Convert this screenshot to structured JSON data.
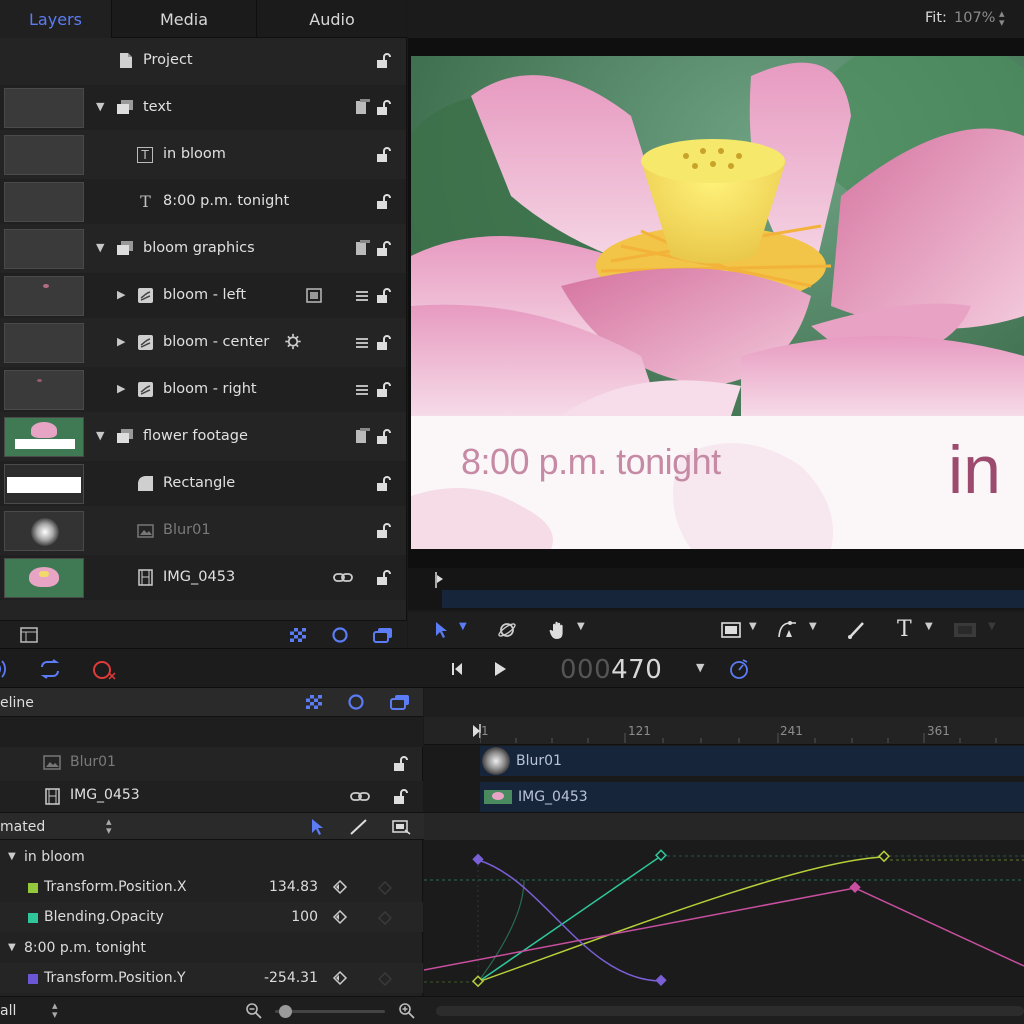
{
  "tabs": [
    {
      "label": "Layers",
      "active": true
    },
    {
      "label": "Media",
      "active": false
    },
    {
      "label": "Audio",
      "active": false
    }
  ],
  "fit": {
    "label": "Fit:",
    "value": "107%"
  },
  "layers": [
    {
      "name": "Project",
      "indent": 1,
      "icon": "document-icon"
    },
    {
      "name": "text",
      "indent": 0,
      "icon": "group-icon",
      "disclosure": "open"
    },
    {
      "name": "in bloom",
      "indent": 1,
      "icon": "text-layer-icon"
    },
    {
      "name": "8:00 p.m. tonight",
      "indent": 1,
      "icon": "text-layer-icon"
    },
    {
      "name": "bloom graphics",
      "indent": 0,
      "icon": "group-icon",
      "disclosure": "open"
    },
    {
      "name": "bloom - left",
      "indent": 1,
      "icon": "emitter-icon",
      "disclosure": "closed"
    },
    {
      "name": "bloom - center",
      "indent": 1,
      "icon": "emitter-icon",
      "disclosure": "closed"
    },
    {
      "name": "bloom - right",
      "indent": 1,
      "icon": "emitter-icon",
      "disclosure": "closed"
    },
    {
      "name": "flower footage",
      "indent": 0,
      "icon": "group-icon",
      "disclosure": "open"
    },
    {
      "name": "Rectangle",
      "indent": 1,
      "icon": "shape-icon"
    },
    {
      "name": "Blur01",
      "indent": 1,
      "icon": "image-icon"
    },
    {
      "name": "IMG_0453",
      "indent": 1,
      "icon": "film-icon"
    }
  ],
  "canvas": {
    "caption_time": "8:00 p.m. tonight",
    "caption_title": "in"
  },
  "transport": {
    "timecode_dim": "000",
    "timecode_value": "470"
  },
  "timeline": {
    "label": "eline",
    "ruler": [
      "1",
      "121",
      "241",
      "361"
    ],
    "tracks": [
      {
        "name": "Blur01"
      },
      {
        "name": "IMG_0453"
      }
    ]
  },
  "keyframes": {
    "filter": "mated",
    "groups": [
      {
        "name": "in bloom"
      },
      {
        "name": "8:00 p.m. tonight"
      }
    ],
    "params": [
      {
        "name": "Transform.Position.X",
        "value": "134.83",
        "color": "#93c93a"
      },
      {
        "name": "Blending.Opacity",
        "value": "100",
        "color": "#2fc79a"
      },
      {
        "name": "Transform.Position.Y",
        "value": "-254.31",
        "color": "#6b57d6"
      }
    ]
  },
  "footer": {
    "zoom_label": "all"
  },
  "colors": {
    "accent": "#5b7cf5",
    "record": "#e03a3a"
  }
}
